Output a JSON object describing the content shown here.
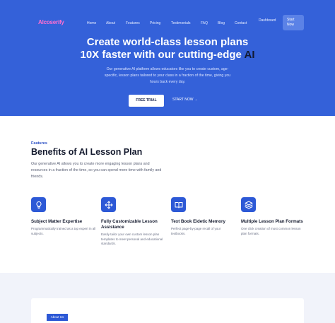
{
  "nav": {
    "logo": "Alcoserify",
    "items": [
      "Home",
      "About",
      "Features",
      "Pricing",
      "Testimonials",
      "FAQ",
      "Blog",
      "Contact"
    ],
    "dashboard": "Dashboard",
    "start_line1": "Start",
    "start_line2": "Now"
  },
  "hero": {
    "title_line1": "Create world-class lesson plans",
    "title_line2_pre": "10X faster with our cutting-edge",
    "title_line2_ai": "AI",
    "subtitle": "Our generative AI platform allows educators like you to create custom, age-specific, lesson plans tailored to your class in a fraction of the time, giving you hours back every day.",
    "trial_button": "FREE TRIAL",
    "start_button": "START NOW →"
  },
  "features": {
    "kicker": "Features",
    "title": "Benefits of AI Lesson Plan",
    "description": "Our generative AI allows you to create more engaging lesson plans and resources in a fraction of the time, so you can spend more time with family and friends.",
    "cards": [
      {
        "icon": "lightbulb-icon",
        "title": "Subject Matter Expertise",
        "desc": "Programmatically trained as a top expert in all subjects."
      },
      {
        "icon": "move-icon",
        "title": "Fully Customizable Lesson Assistance",
        "desc": "Easily tailor your own custom lesson plan templates to meet personal and educational standards."
      },
      {
        "icon": "book-icon",
        "title": "Text Book Eidetic Memory",
        "desc": "Perfect page-by-page recall of your textbooks."
      },
      {
        "icon": "layers-icon",
        "title": "Multiple Lesson Plan Formats",
        "desc": "One click creation of most common lesson plan formats."
      }
    ]
  },
  "about": {
    "badge": "About Us"
  },
  "colors": {
    "brand_blue": "#3461d9",
    "accent_pink": "#ff6fd1",
    "icon_blue": "#2d59d6"
  }
}
